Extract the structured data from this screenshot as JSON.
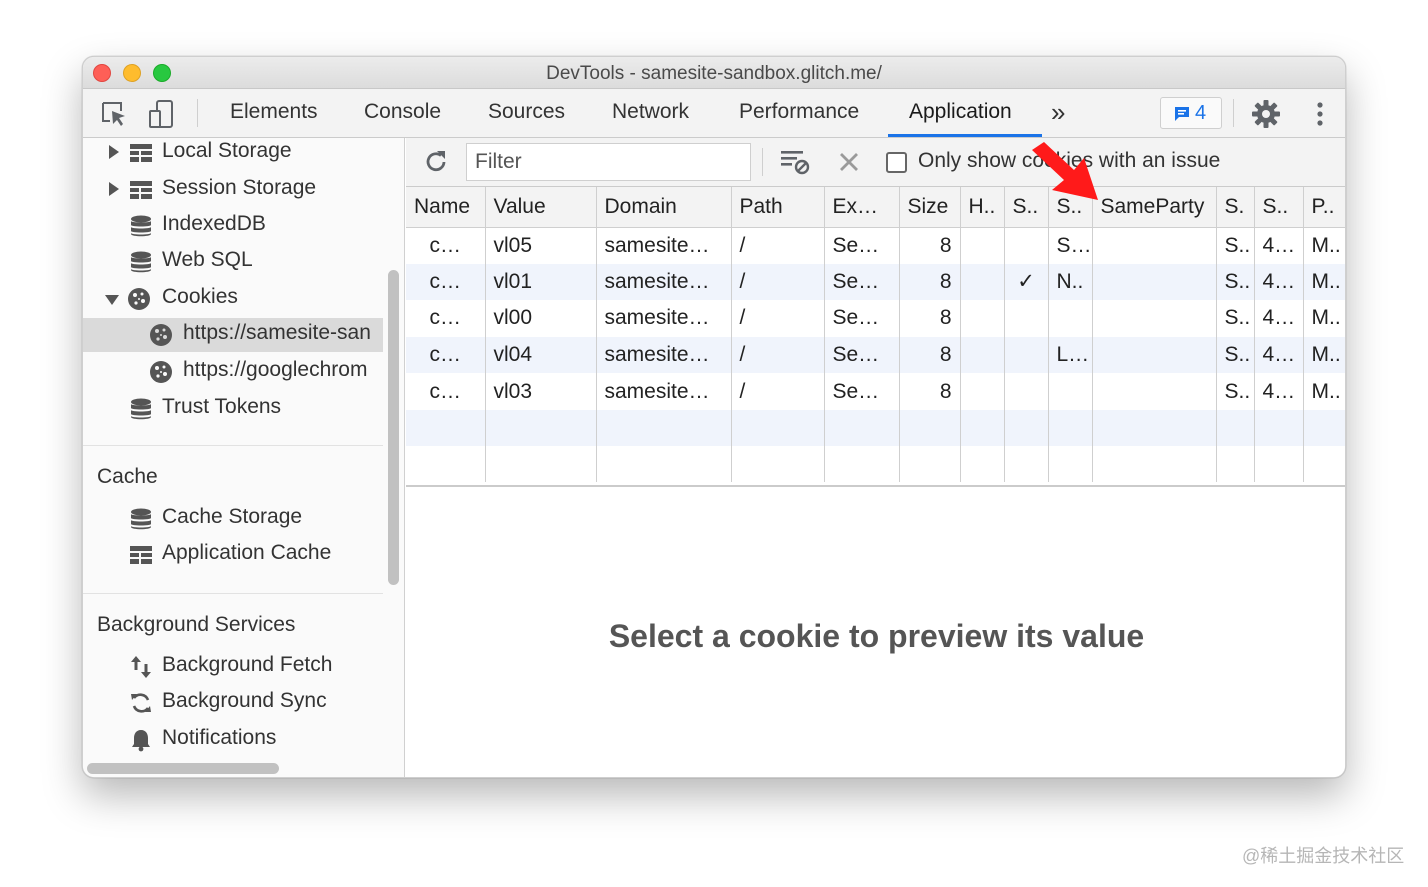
{
  "window": {
    "title": "DevTools - samesite-sandbox.glitch.me/"
  },
  "toolbar": {
    "tabs": [
      {
        "label": "Elements"
      },
      {
        "label": "Console"
      },
      {
        "label": "Sources"
      },
      {
        "label": "Network"
      },
      {
        "label": "Performance"
      },
      {
        "label": "Application",
        "active": true
      }
    ],
    "more_label": "»",
    "issues_count": "4",
    "accent_color": "#1a73e8"
  },
  "sidebar": {
    "storage_items": [
      {
        "label": "Local Storage",
        "icon": "table-grid-icon",
        "expand": "collapsed"
      },
      {
        "label": "Session Storage",
        "icon": "table-grid-icon",
        "expand": "collapsed"
      },
      {
        "label": "IndexedDB",
        "icon": "database-icon"
      },
      {
        "label": "Web SQL",
        "icon": "database-icon"
      },
      {
        "label": "Cookies",
        "icon": "cookie-icon",
        "expand": "expanded"
      },
      {
        "label": "https://samesite-san",
        "icon": "cookie-icon",
        "selected": true
      },
      {
        "label": "https://googlechrom",
        "icon": "cookie-icon"
      },
      {
        "label": "Trust Tokens",
        "icon": "database-icon"
      }
    ],
    "cache_header": "Cache",
    "cache_items": [
      {
        "label": "Cache Storage",
        "icon": "database-icon"
      },
      {
        "label": "Application Cache",
        "icon": "table-grid-icon"
      }
    ],
    "bg_header": "Background Services",
    "bg_items": [
      {
        "label": "Background Fetch",
        "icon": "up-down-arrows-icon"
      },
      {
        "label": "Background Sync",
        "icon": "sync-icon"
      },
      {
        "label": "Notifications",
        "icon": "bell-icon"
      }
    ]
  },
  "filterbar": {
    "filter_placeholder": "Filter",
    "checkbox_label": "Only show cookies with an issue"
  },
  "cookie_table": {
    "columns": [
      "Name",
      "Value",
      "Domain",
      "Path",
      "Ex…",
      "Size",
      "H..",
      "S..",
      "S..",
      "SameParty",
      "S.",
      "S..",
      "P.."
    ],
    "rows": [
      [
        "c…",
        "vl05",
        "samesite…",
        "/",
        "Se…",
        "8",
        "",
        "",
        "S…",
        "",
        "S..",
        "4…",
        "M.."
      ],
      [
        "c…",
        "vl01",
        "samesite…",
        "/",
        "Se…",
        "8",
        "",
        "✓",
        "N..",
        "",
        "S..",
        "4…",
        "M.."
      ],
      [
        "c…",
        "vl00",
        "samesite…",
        "/",
        "Se…",
        "8",
        "",
        "",
        "",
        "",
        "S..",
        "4…",
        "M.."
      ],
      [
        "c…",
        "vl04",
        "samesite…",
        "/",
        "Se…",
        "8",
        "",
        "",
        "L…",
        "",
        "S..",
        "4…",
        "M.."
      ],
      [
        "c…",
        "vl03",
        "samesite…",
        "/",
        "Se…",
        "8",
        "",
        "",
        "",
        "",
        "S..",
        "4…",
        "M.."
      ]
    ]
  },
  "preview": {
    "message": "Select a cookie to preview its value"
  },
  "annotation": {
    "arrow_color": "#ff0000"
  },
  "watermark": "@稀土掘金技术社区"
}
